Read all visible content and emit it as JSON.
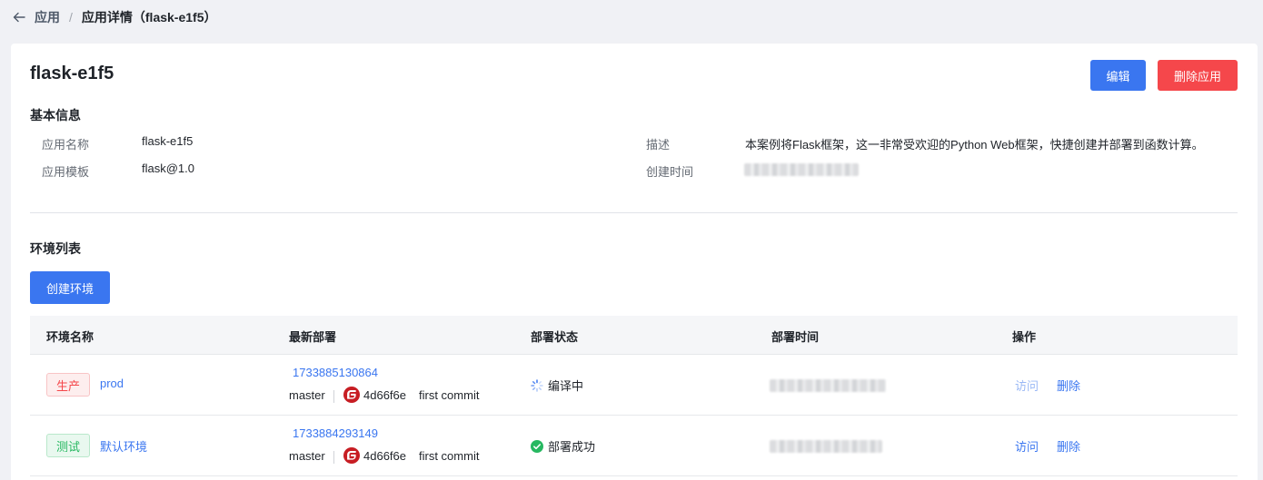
{
  "breadcrumb": {
    "parent": "应用",
    "separator": "/",
    "current": "应用详情（flask-e1f5）"
  },
  "app": {
    "title": "flask-e1f5",
    "edit_label": "编辑",
    "delete_label": "删除应用"
  },
  "basic_info": {
    "title": "基本信息",
    "name_label": "应用名称",
    "name_value": "flask-e1f5",
    "template_label": "应用模板",
    "template_value": "flask@1.0",
    "desc_label": "描述",
    "desc_value": "本案例将Flask框架，这一非常受欢迎的Python Web框架，快捷创建并部署到函数计算。",
    "created_label": "创建时间"
  },
  "env_list": {
    "title": "环境列表",
    "create_label": "创建环境",
    "columns": [
      "环境名称",
      "最新部署",
      "部署状态",
      "部署时间",
      "操作"
    ],
    "rows": [
      {
        "tag": "生产",
        "name": "prod",
        "deploy_id": "1733885130864",
        "branch": "master",
        "commit": "4d66f6e",
        "message": "first commit",
        "status": "编译中",
        "visit": "访问",
        "delete": "删除"
      },
      {
        "tag": "测试",
        "name": "默认环境",
        "deploy_id": "1733884293149",
        "branch": "master",
        "commit": "4d66f6e",
        "message": "first commit",
        "status": "部署成功",
        "visit": "访问",
        "delete": "删除"
      }
    ]
  },
  "colors": {
    "primary": "#3a76f0",
    "danger": "#f5474b",
    "success": "#27b861",
    "gitee": "#c71d23"
  }
}
